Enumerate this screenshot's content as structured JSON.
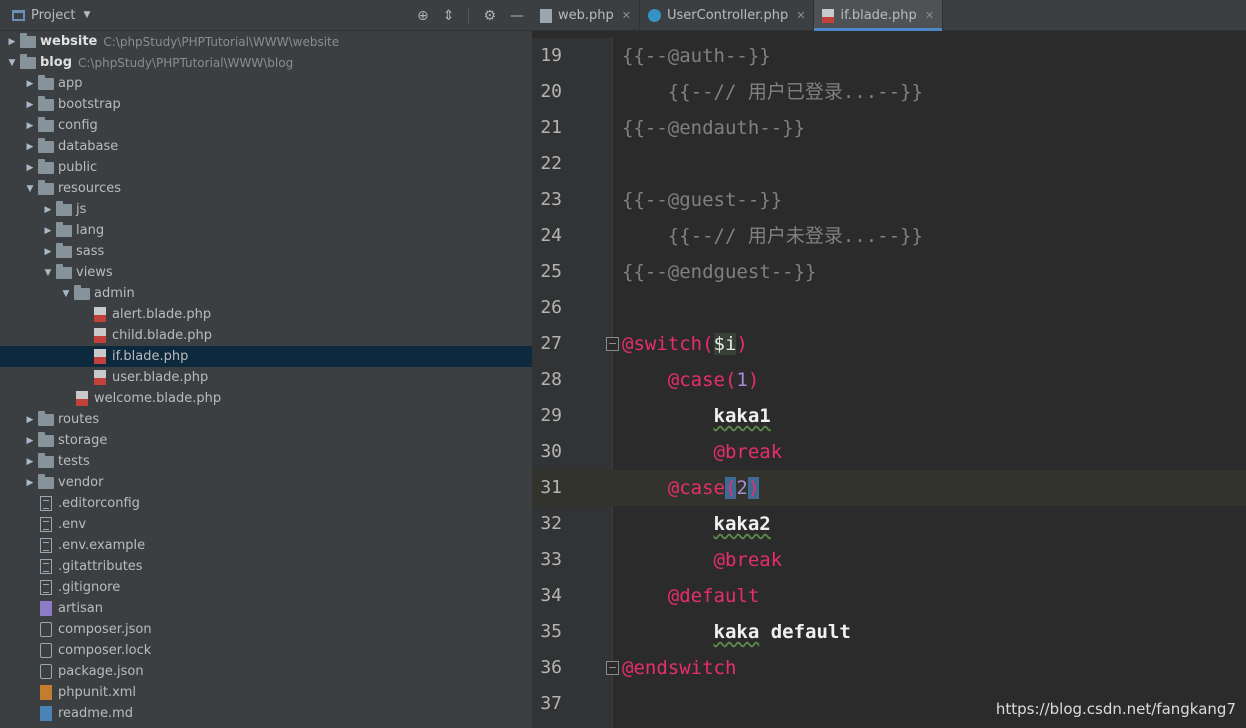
{
  "project_panel": {
    "title": "Project",
    "tree": [
      {
        "label": "website",
        "path": "C:\\phpStudy\\PHPTutorial\\WWW\\website",
        "type": "module",
        "depth": 0,
        "expanded": false,
        "bold": true
      },
      {
        "label": "blog",
        "path": "C:\\phpStudy\\PHPTutorial\\WWW\\blog",
        "type": "module",
        "depth": 0,
        "expanded": true,
        "bold": true
      },
      {
        "label": "app",
        "type": "folder",
        "depth": 1,
        "expanded": false
      },
      {
        "label": "bootstrap",
        "type": "folder",
        "depth": 1,
        "expanded": false
      },
      {
        "label": "config",
        "type": "folder",
        "depth": 1,
        "expanded": false
      },
      {
        "label": "database",
        "type": "folder",
        "depth": 1,
        "expanded": false
      },
      {
        "label": "public",
        "type": "folder",
        "depth": 1,
        "expanded": false
      },
      {
        "label": "resources",
        "type": "folder",
        "depth": 1,
        "expanded": true
      },
      {
        "label": "js",
        "type": "folder",
        "depth": 2,
        "expanded": false
      },
      {
        "label": "lang",
        "type": "folder",
        "depth": 2,
        "expanded": false
      },
      {
        "label": "sass",
        "type": "folder",
        "depth": 2,
        "expanded": false
      },
      {
        "label": "views",
        "type": "folder",
        "depth": 2,
        "expanded": true
      },
      {
        "label": "admin",
        "type": "folder",
        "depth": 3,
        "expanded": true
      },
      {
        "label": "alert.blade.php",
        "type": "blade",
        "depth": 4
      },
      {
        "label": "child.blade.php",
        "type": "blade",
        "depth": 4
      },
      {
        "label": "if.blade.php",
        "type": "blade",
        "depth": 4,
        "selected": true
      },
      {
        "label": "user.blade.php",
        "type": "blade",
        "depth": 4
      },
      {
        "label": "welcome.blade.php",
        "type": "blade",
        "depth": 3
      },
      {
        "label": "routes",
        "type": "folder",
        "depth": 1,
        "expanded": false
      },
      {
        "label": "storage",
        "type": "folder",
        "depth": 1,
        "expanded": false
      },
      {
        "label": "tests",
        "type": "folder",
        "depth": 1,
        "expanded": false
      },
      {
        "label": "vendor",
        "type": "folder",
        "depth": 1,
        "expanded": false
      },
      {
        "label": ".editorconfig",
        "type": "text",
        "depth": 1
      },
      {
        "label": ".env",
        "type": "text",
        "depth": 1
      },
      {
        "label": ".env.example",
        "type": "text",
        "depth": 1
      },
      {
        "label": ".gitattributes",
        "type": "text",
        "depth": 1
      },
      {
        "label": ".gitignore",
        "type": "text",
        "depth": 1
      },
      {
        "label": "artisan",
        "type": "php",
        "depth": 1
      },
      {
        "label": "composer.json",
        "type": "json",
        "depth": 1
      },
      {
        "label": "composer.lock",
        "type": "json",
        "depth": 1
      },
      {
        "label": "package.json",
        "type": "json",
        "depth": 1
      },
      {
        "label": "phpunit.xml",
        "type": "xml",
        "depth": 1
      },
      {
        "label": "readme.md",
        "type": "md",
        "depth": 1
      }
    ]
  },
  "tabs": [
    {
      "label": "web.php",
      "icon": "php-file-icon",
      "active": false
    },
    {
      "label": "UserController.php",
      "icon": "class-icon",
      "active": false
    },
    {
      "label": "if.blade.php",
      "icon": "blade-file-icon",
      "active": true
    }
  ],
  "code_lines": [
    {
      "num": "19",
      "segs": [
        {
          "t": "{{--@auth--}}",
          "c": "cm"
        }
      ]
    },
    {
      "num": "20",
      "segs": [
        {
          "t": "    {{--// 用户已登录...--}}",
          "c": "cm"
        }
      ]
    },
    {
      "num": "21",
      "segs": [
        {
          "t": "{{--@endauth--}}",
          "c": "cm"
        }
      ]
    },
    {
      "num": "22",
      "segs": []
    },
    {
      "num": "23",
      "segs": [
        {
          "t": "{{--@guest--}}",
          "c": "cm"
        }
      ]
    },
    {
      "num": "24",
      "segs": [
        {
          "t": "    {{--// 用户未登录...--}}",
          "c": "cm"
        }
      ]
    },
    {
      "num": "25",
      "segs": [
        {
          "t": "{{--@endguest--}}",
          "c": "cm"
        }
      ]
    },
    {
      "num": "26",
      "segs": []
    },
    {
      "num": "27",
      "fold": true,
      "segs": [
        {
          "t": "@switch(",
          "c": "dir"
        },
        {
          "t": "$i",
          "c": "var"
        },
        {
          "t": ")",
          "c": "dir"
        }
      ]
    },
    {
      "num": "28",
      "segs": [
        {
          "t": "    @case(",
          "c": "dir"
        },
        {
          "t": "1",
          "c": "num"
        },
        {
          "t": ")",
          "c": "dir"
        }
      ]
    },
    {
      "num": "29",
      "segs": [
        {
          "t": "        ",
          "c": ""
        },
        {
          "t": "kaka1",
          "c": "txt wave"
        }
      ]
    },
    {
      "num": "30",
      "segs": [
        {
          "t": "        @break",
          "c": "dir"
        }
      ]
    },
    {
      "num": "31",
      "current": true,
      "segs": [
        {
          "t": "    @case",
          "c": "dir"
        },
        {
          "t": "(",
          "c": "dir hl"
        },
        {
          "t": "2",
          "c": "num"
        },
        {
          "t": ")",
          "c": "dir hl"
        }
      ]
    },
    {
      "num": "32",
      "segs": [
        {
          "t": "        ",
          "c": ""
        },
        {
          "t": "kaka2",
          "c": "txt wave"
        }
      ]
    },
    {
      "num": "33",
      "segs": [
        {
          "t": "        @break",
          "c": "dir"
        }
      ]
    },
    {
      "num": "34",
      "segs": [
        {
          "t": "    @default",
          "c": "dir"
        }
      ]
    },
    {
      "num": "35",
      "segs": [
        {
          "t": "        ",
          "c": ""
        },
        {
          "t": "kaka",
          "c": "txt wave"
        },
        {
          "t": " default",
          "c": "txt"
        }
      ]
    },
    {
      "num": "36",
      "fold": true,
      "segs": [
        {
          "t": "@endswitch",
          "c": "dir"
        }
      ]
    },
    {
      "num": "37",
      "segs": []
    }
  ],
  "watermark": "https://blog.csdn.net/fangkang7"
}
